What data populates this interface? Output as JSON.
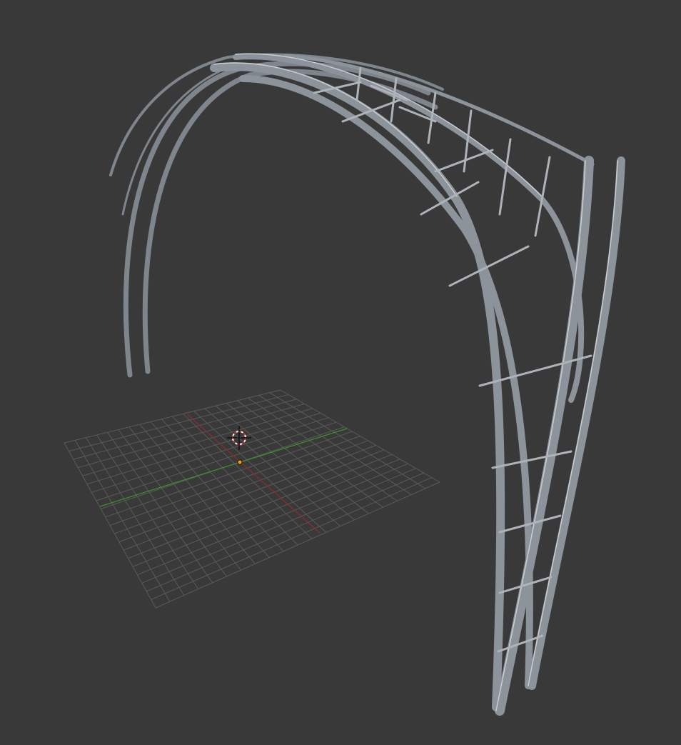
{
  "viewport": {
    "background_color": "#393939",
    "grid_color": "#5a5a5a",
    "x_axis_color": "#8a2e2e",
    "y_axis_color": "#3f8f2f",
    "model_color": "#8d939b",
    "model_edge_color": "#c9cdd2",
    "origin_color": "#f0a020",
    "cursor_color": "#d03030"
  }
}
